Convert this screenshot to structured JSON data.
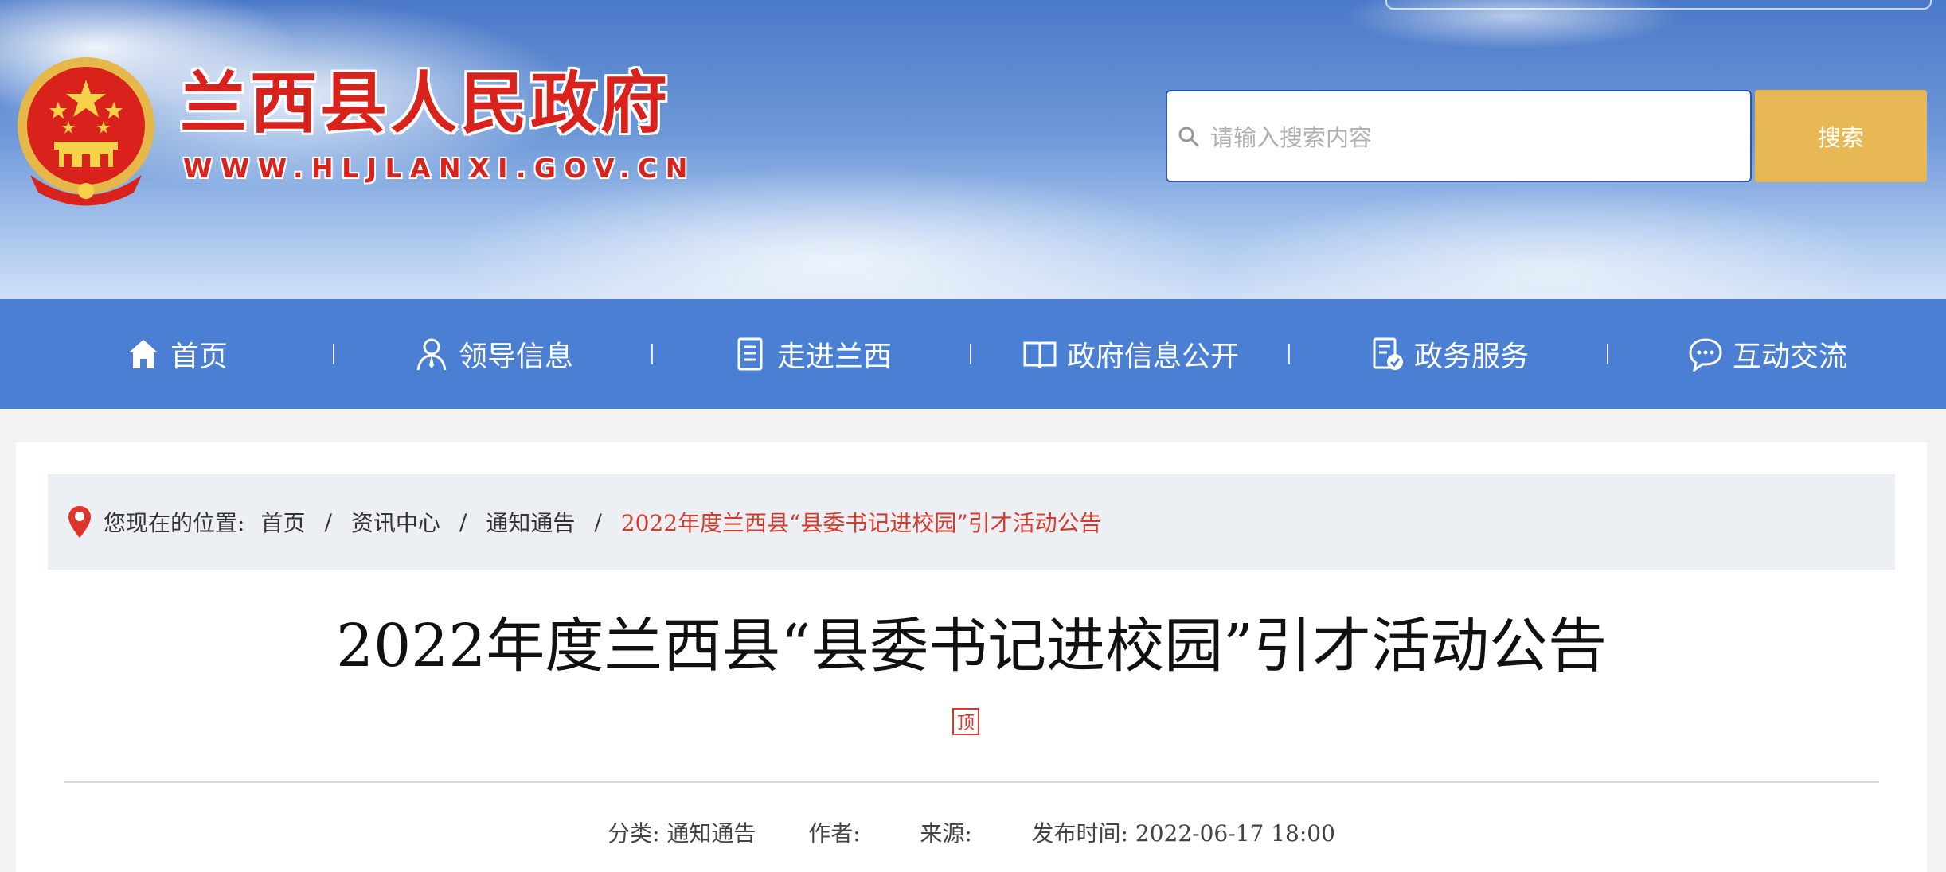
{
  "header": {
    "site_title": "兰西县人民政府",
    "site_url": "WWW.HLJLANXI.GOV.CN",
    "search_placeholder": "请输入搜索内容",
    "search_button": "搜索"
  },
  "nav": {
    "items": [
      {
        "label": "首页",
        "icon": "home-icon"
      },
      {
        "label": "领导信息",
        "icon": "person-icon"
      },
      {
        "label": "走进兰西",
        "icon": "document-icon"
      },
      {
        "label": "政府信息公开",
        "icon": "book-icon"
      },
      {
        "label": "政务服务",
        "icon": "service-check-icon"
      },
      {
        "label": "互动交流",
        "icon": "chat-bubble-icon"
      }
    ]
  },
  "breadcrumb": {
    "prefix": "您现在的位置:",
    "items": [
      "首页",
      "资讯中心",
      "通知通告"
    ],
    "separator": "/",
    "current": "2022年度兰西县“县委书记进校园”引才活动公告"
  },
  "article": {
    "title": "2022年度兰西县“县委书记进校园”引才活动公告",
    "pin_badge": "顶",
    "meta": {
      "category_label": "分类:",
      "category": "通知通告",
      "author_label": "作者:",
      "author": "",
      "source_label": "来源:",
      "source": "",
      "publish_label": "发布时间:",
      "publish_time": "2022-06-17 18:00"
    }
  },
  "colors": {
    "nav_bg": "#4a7fd3",
    "title_red": "#d8221b",
    "search_button": "#e8b854",
    "breadcrumb_current": "#d63a2b"
  }
}
